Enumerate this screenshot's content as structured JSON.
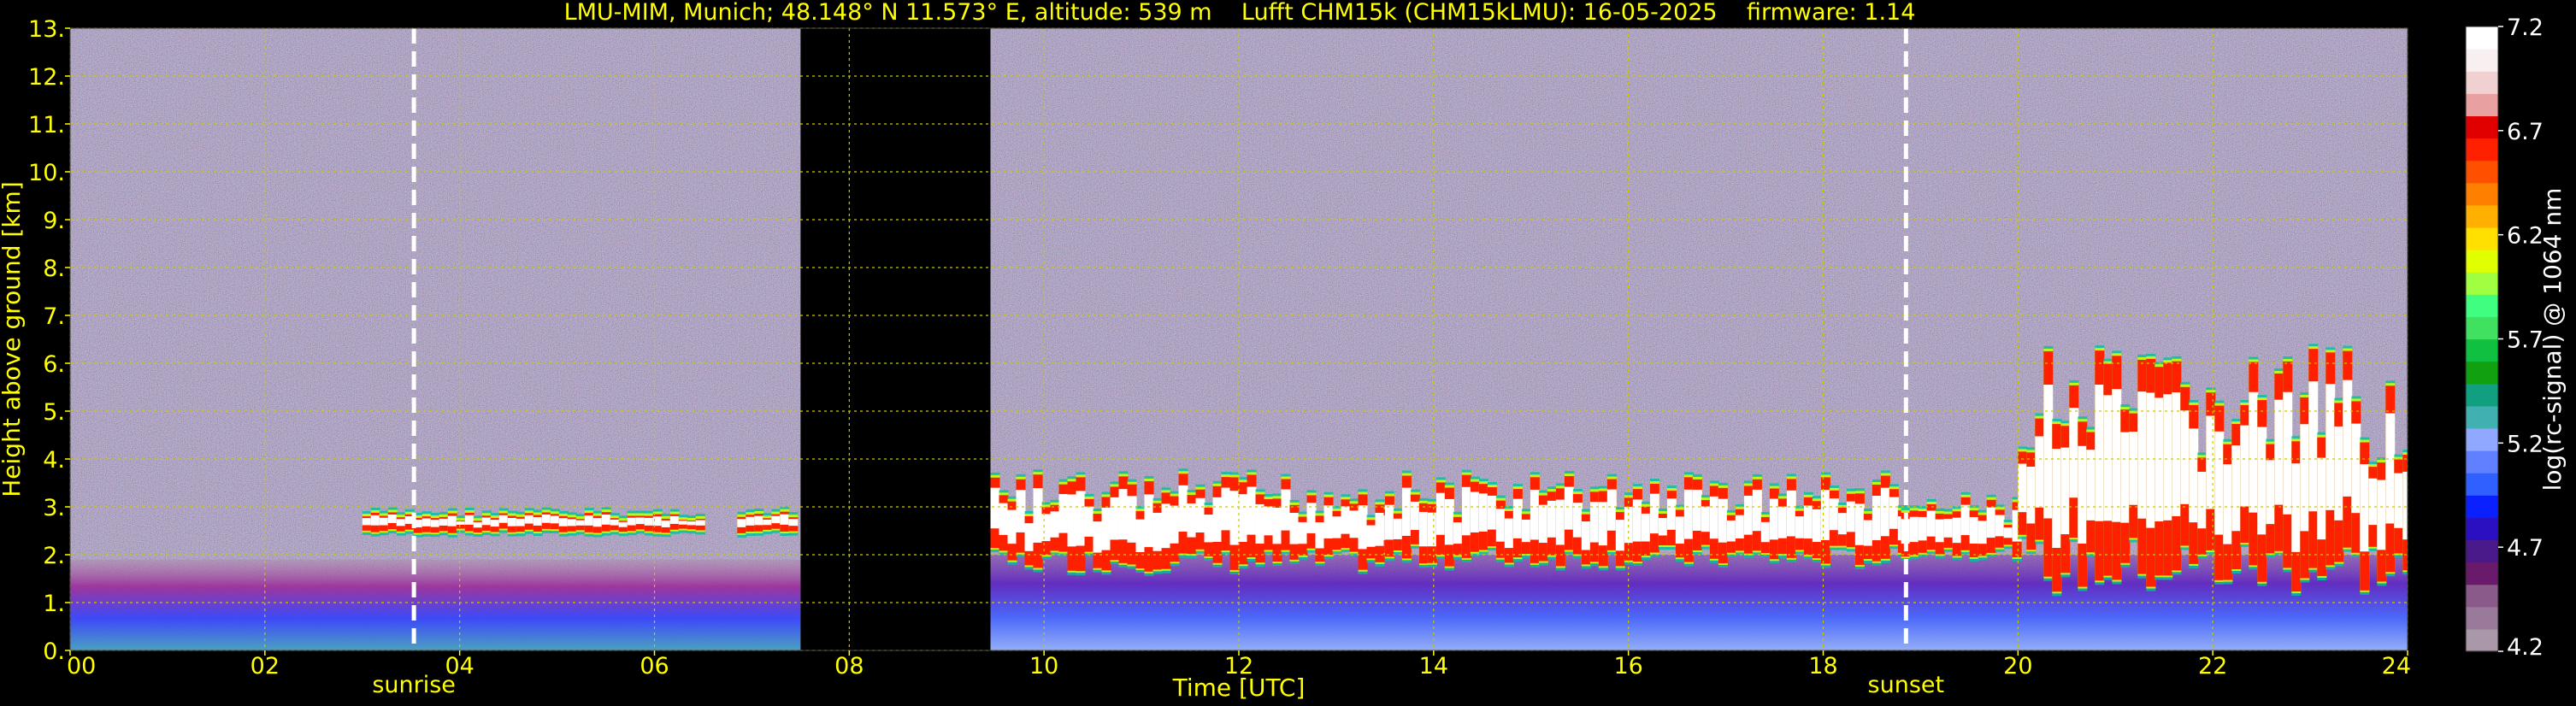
{
  "chart_data": {
    "type": "heatmap",
    "title": "LMU-MIM, Munich; 48.148° N 11.573° E, altitude: 539 m    Lufft CHM15k (CHM15kLMU): 16-05-2025    firmware: 1.14",
    "xlabel": "Time [UTC]",
    "ylabel": "Height above ground [km]",
    "xlim": [
      0,
      24
    ],
    "ylim": [
      0,
      13
    ],
    "x_ticks": [
      "00",
      "02",
      "04",
      "06",
      "08",
      "10",
      "12",
      "14",
      "16",
      "18",
      "20",
      "22",
      "24"
    ],
    "y_ticks": [
      "0.",
      "1.",
      "2.",
      "3.",
      "4.",
      "5.",
      "6.",
      "7.",
      "8.",
      "9.",
      "10.",
      "11.",
      "12.",
      "13."
    ],
    "grid": true,
    "colorbar": {
      "label": "log(rc-signal) @ 1064 nm",
      "range": [
        4.2,
        7.2
      ],
      "ticks": [
        "4.2",
        "4.7",
        "5.2",
        "5.7",
        "6.2",
        "6.7",
        "7.2"
      ],
      "colors": [
        "#a898a8",
        "#9a7a9a",
        "#8a5a8a",
        "#6a1a6a",
        "#4a1a8a",
        "#2a10c0",
        "#0a20ff",
        "#3060ff",
        "#6080ff",
        "#90a8ff",
        "#40b0b0",
        "#10a080",
        "#10a010",
        "#10c040",
        "#40e060",
        "#40ff80",
        "#a0ff40",
        "#e0ff00",
        "#ffe000",
        "#ffb000",
        "#ff8000",
        "#ff5000",
        "#ff2000",
        "#e00000",
        "#e8a0a0",
        "#f0d0d0",
        "#f8f0f0",
        "#ffffff"
      ]
    },
    "markers": [
      {
        "label": "sunrise",
        "time": 3.53
      },
      {
        "label": "sunset",
        "time": 18.85
      }
    ],
    "no_data_intervals": [
      [
        7.5,
        9.45
      ]
    ],
    "cloud_layers": [
      {
        "start": 3.0,
        "end": 6.5,
        "base_km": 2.5,
        "top_km": 2.9
      },
      {
        "start": 6.85,
        "end": 7.45,
        "base_km": 2.5,
        "top_km": 2.9
      },
      {
        "start": 9.45,
        "end": 13.5,
        "base_km": 1.7,
        "top_km": 3.7
      },
      {
        "start": 13.5,
        "end": 18.8,
        "base_km": 1.8,
        "top_km": 3.7
      },
      {
        "start": 18.8,
        "end": 20.0,
        "base_km": 2.0,
        "top_km": 3.2
      },
      {
        "start": 20.0,
        "end": 24.0,
        "base_km": 1.2,
        "top_km": 6.3
      }
    ],
    "boundary_layer": [
      {
        "start": 0,
        "end": 7.5,
        "top_km": 1.9
      },
      {
        "start": 9.45,
        "end": 24,
        "top_km": 2.0
      }
    ]
  }
}
